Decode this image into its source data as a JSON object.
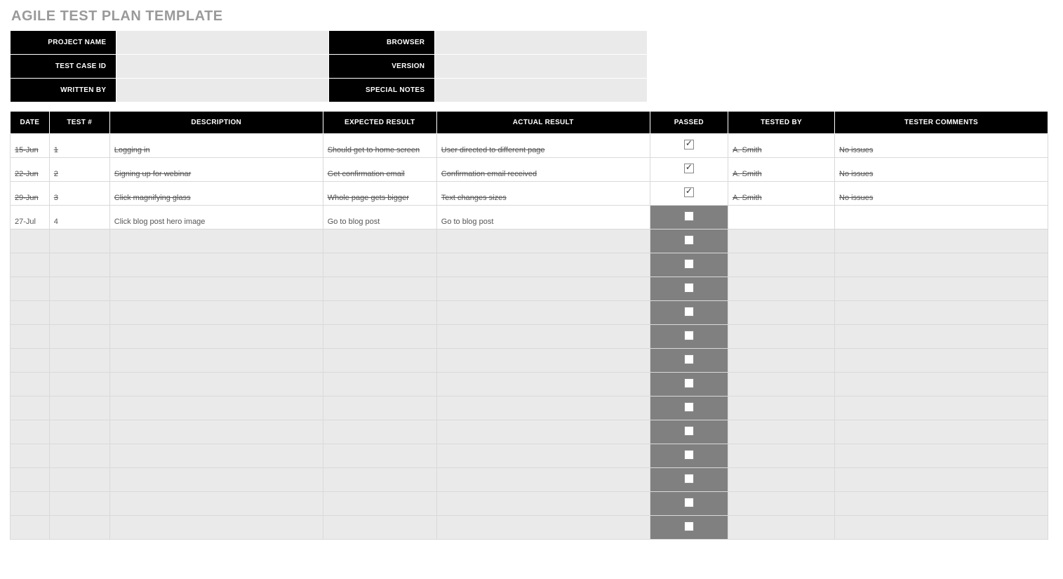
{
  "title": "AGILE TEST PLAN TEMPLATE",
  "meta": {
    "rows": [
      {
        "l1": "PROJECT NAME",
        "v1": "",
        "l2": "BROWSER",
        "v2": ""
      },
      {
        "l1": "TEST CASE ID",
        "v1": "",
        "l2": "VERSION",
        "v2": ""
      },
      {
        "l1": "WRITTEN BY",
        "v1": "",
        "l2": "SPECIAL NOTES",
        "v2": ""
      }
    ]
  },
  "columns": [
    "DATE",
    "TEST #",
    "DESCRIPTION",
    "EXPECTED RESULT",
    "ACTUAL RESULT",
    "PASSED",
    "TESTED BY",
    "TESTER COMMENTS"
  ],
  "rows": [
    {
      "date": "15-Jun",
      "test": "1",
      "desc": "Logging in",
      "exp": "Should get to home screen",
      "act": "User directed to different page",
      "passed": true,
      "testby": "A. Smith",
      "comm": "No issues",
      "strike": true
    },
    {
      "date": "22-Jun",
      "test": "2",
      "desc": "Signing up for webinar",
      "exp": "Get confirmation email",
      "act": "Confirmation email received",
      "passed": true,
      "testby": "A. Smith",
      "comm": "No issues",
      "strike": true
    },
    {
      "date": "29-Jun",
      "test": "3",
      "desc": "Click magnifying glass",
      "exp": "Whole page gets bigger",
      "act": "Text changes sizes",
      "passed": true,
      "testby": "A. Smith",
      "comm": "No issues",
      "strike": true
    },
    {
      "date": "27-Jul",
      "test": "4",
      "desc": "Click blog post hero image",
      "exp": "Go to blog post",
      "act": "Go to blog post",
      "passed": false,
      "testby": "",
      "comm": "",
      "strike": false
    }
  ],
  "emptyRowCount": 13
}
